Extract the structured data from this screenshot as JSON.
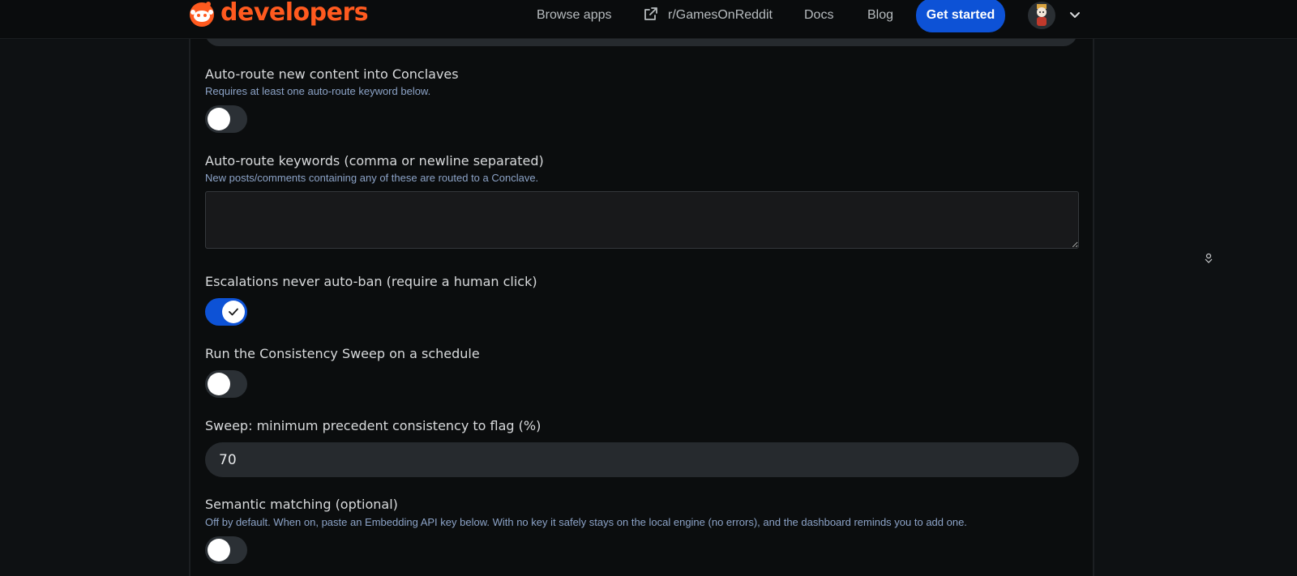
{
  "header": {
    "brand": "developers",
    "nav": {
      "browse_apps": "Browse apps",
      "subreddit": "r/GamesOnReddit",
      "docs": "Docs",
      "blog": "Blog"
    },
    "get_started": "Get started"
  },
  "settings": {
    "auto_route": {
      "label": "Auto-route new content into Conclaves",
      "hint": "Requires at least one auto-route keyword below.",
      "enabled": false
    },
    "keywords": {
      "label": "Auto-route keywords (comma or newline separated)",
      "hint": "New posts/comments containing any of these are routed to a Conclave.",
      "value": ""
    },
    "escalations": {
      "label": "Escalations never auto-ban (require a human click)",
      "enabled": true
    },
    "sweep_schedule": {
      "label": "Run the Consistency Sweep on a schedule",
      "enabled": false
    },
    "sweep_min": {
      "label": "Sweep: minimum precedent consistency to flag (%)",
      "value": "70"
    },
    "semantic": {
      "label": "Semantic matching (optional)",
      "hint": "Off by default. When on, paste an Embedding API key below. With no key it safely stays on the local engine (no errors), and the dashboard reminds you to add one.",
      "enabled": false
    }
  },
  "colors": {
    "accent": "#0d52d6",
    "brand": "#ff5a1f",
    "hint": "#8ca3c7"
  }
}
